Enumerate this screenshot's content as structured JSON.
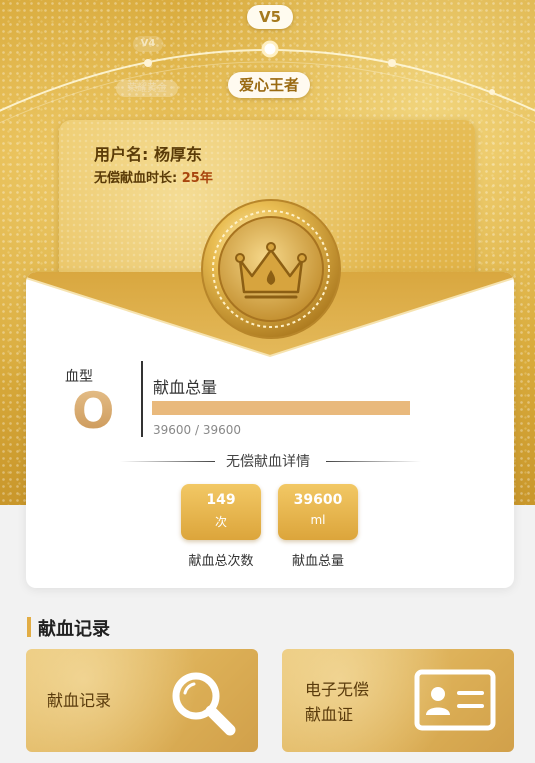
{
  "levels": {
    "current": "V5",
    "previous": "V4",
    "current_title": "爱心王者",
    "previous_title": "荣耀黄金"
  },
  "profile": {
    "username_label": "用户名: 杨厚东",
    "years_label": "无偿献血时长:",
    "years_value": "25年"
  },
  "blood": {
    "type_label": "血型",
    "type_value": "O",
    "total_label": "献血总量",
    "progress_text": "39600 / 39600",
    "progress_fraction": 1.0
  },
  "details": {
    "heading": "无偿献血详情",
    "stats": [
      {
        "value": "149",
        "unit": "次",
        "caption": "献血总次数"
      },
      {
        "value": "39600",
        "unit": "ml",
        "caption": "献血总量"
      }
    ]
  },
  "records": {
    "section_title": "献血记录",
    "tiles": [
      {
        "label": "献血记录",
        "icon": "search-icon"
      },
      {
        "label_line1": "电子无偿",
        "label_line2": "献血证",
        "icon": "id-card-icon"
      }
    ]
  },
  "colors": {
    "gold": "#e2b54a",
    "progress": "#e9b97c",
    "accent_text": "#a8450f"
  }
}
